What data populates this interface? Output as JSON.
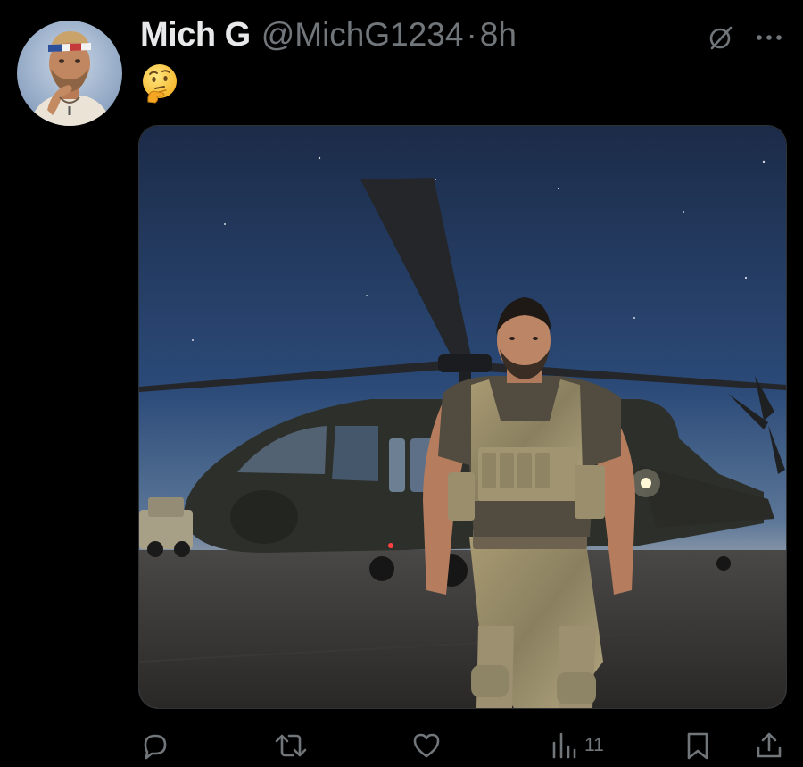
{
  "tweet": {
    "display_name": "Mich G",
    "handle": "@MichG1234",
    "separator": "·",
    "timestamp": "8h",
    "text_emoji": "thinking-face-emoji",
    "media_description_icon": "photo"
  },
  "actions": {
    "reply_icon": "speech-bubble-icon",
    "retweet_icon": "retweet-arrows-icon",
    "like_icon": "heart-icon",
    "views_icon": "bar-chart-icon",
    "views_count": "11",
    "bookmark_icon": "bookmark-icon",
    "share_icon": "share-upload-icon"
  },
  "header_icons": {
    "grok": "grok-slash-circle-icon",
    "more": "more-dots-icon"
  },
  "colors": {
    "background": "#000000",
    "primary_text": "#e7e9ea",
    "secondary_text": "#71767b",
    "border": "#2f3336"
  }
}
